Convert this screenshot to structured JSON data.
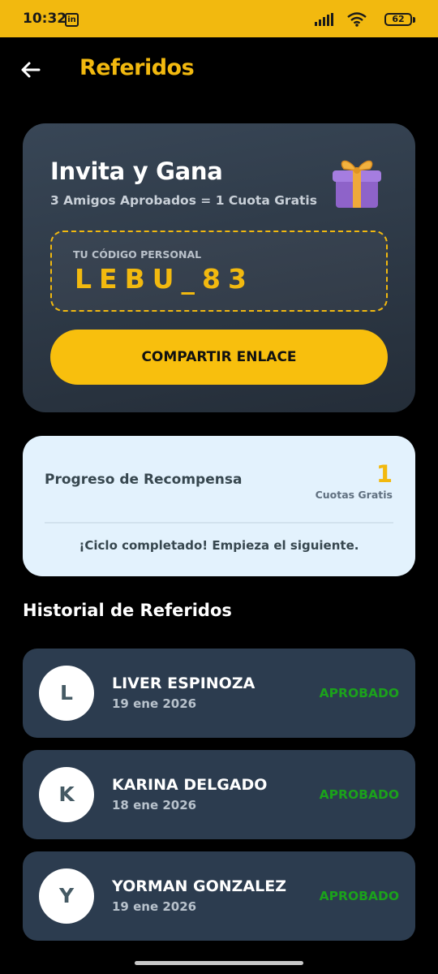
{
  "status_bar": {
    "time": "10:32",
    "app_icon": "linkedin-icon",
    "battery": "62"
  },
  "header": {
    "title": "Referidos",
    "back_icon": "back-arrow-icon"
  },
  "invite": {
    "title": "Invita y Gana",
    "subtitle": "3 Amigos Aprobados = 1 Cuota Gratis",
    "gift_icon": "gift-icon",
    "code_label": "TU CÓDIGO PERSONAL",
    "code": "LEBU_83",
    "share_label": "COMPARTIR ENLACE"
  },
  "progress": {
    "title": "Progreso de Recompensa",
    "count": "1",
    "unit": "Cuotas Gratis",
    "message": "¡Ciclo completado! Empieza el siguiente."
  },
  "history": {
    "title": "Historial de Referidos",
    "items": [
      {
        "initial": "L",
        "name": "LIVER ESPINOZA",
        "date": "19 ene 2026",
        "status": "APROBADO"
      },
      {
        "initial": "K",
        "name": "KARINA DELGADO",
        "date": "18 ene 2026",
        "status": "APROBADO"
      },
      {
        "initial": "Y",
        "name": "YORMAN GONZALEZ",
        "date": "19 ene 2026",
        "status": "APROBADO"
      }
    ]
  },
  "colors": {
    "accent": "#F2B90F",
    "background": "#000000",
    "card": "#2C3C4F",
    "progress_card": "#E3F2FD",
    "approved": "#1BA21B"
  }
}
